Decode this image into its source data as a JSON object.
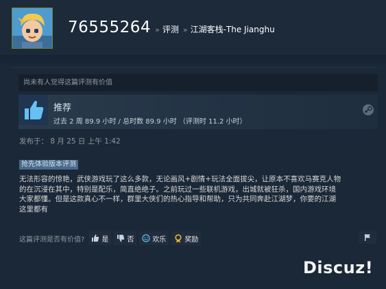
{
  "header": {
    "username": "76555264",
    "breadcrumb_sep": "»",
    "breadcrumb_reviews": "评测",
    "breadcrumb_game": "江湖客栈-The Jianghu"
  },
  "helpful_bar": {
    "text": "尚未有人觉得这篇评测有价值"
  },
  "recommendation": {
    "title": "推荐",
    "hours": "过去 2 周 89.9 小时 / 总时数 89.9 小时 （评测时 11.2 小时）",
    "thumb_icon": "thumbs-up-icon",
    "platform_icon": "steam-icon"
  },
  "posted": "发布于：  8 月 25 日 上午 1:42",
  "early_access_badge": "抢先体验版本评测",
  "review_lines": [
    "无法形容的惊艳，武侠游戏玩了这么多款，无论画风+剧情+玩法全面拔尖，让原本不喜欢马赛克人物",
    "的在沉浸在其中，特别是配乐，简直绝绝子。之前玩过一些联机游戏，出城就被狂杀，国内游戏环境",
    "大家都懂。但是这款真心不一样，群里大侠们的热心指导和帮助，只为共同奔赴江湖梦，你要的江湖",
    "这里都有"
  ],
  "vote": {
    "question": "这篇评测是否有价值?",
    "yes": "是",
    "no": "否",
    "funny": "欢乐",
    "award": "奖励"
  },
  "watermark": "Discuz!",
  "colors": {
    "background": "#1b2838",
    "panel": "#16202d",
    "accent_blue": "#66c0f4",
    "badge": "#4a6a8a"
  }
}
